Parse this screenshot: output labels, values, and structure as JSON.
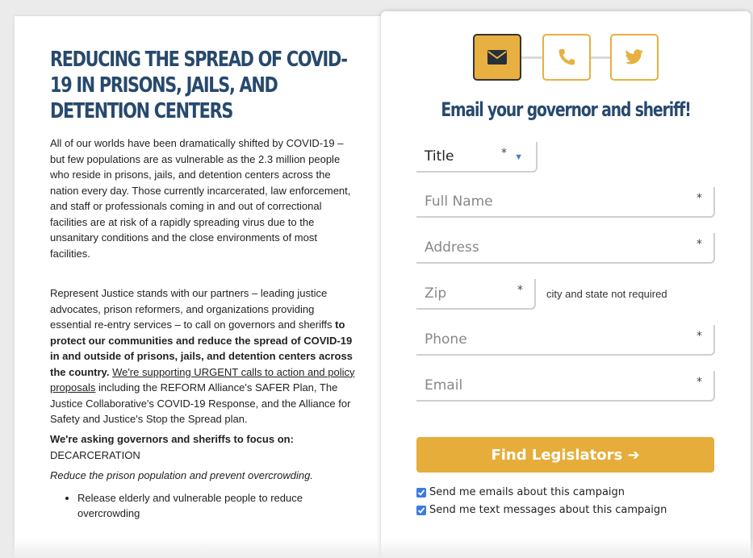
{
  "article": {
    "headline": "REDUCING THE SPREAD OF COVID-19 IN PRISONS, JAILS, AND DETENTION CENTERS",
    "para1": "All of our worlds have been dramatically shifted by COVID-19 – but few populations are as vulnerable as the 2.3 million people who reside in prisons, jails, and detention centers across the nation every day. Those currently incarcerated, law enforcement, and staff or professionals coming in and out of correctional facilities are at risk of a rapidly spreading virus due to the unsanitary conditions and the close environments of most facilities.",
    "para2_a": "Represent Justice stands with our partners – leading justice advocates, prison reformers, and organizations providing essential re-entry services –  to call on governors and sheriffs ",
    "para2_bold": "to protect our communities and reduce the spread of COVID-19 in and outside of prisons, jails, and detention centers across the country.",
    "para2_link": "We're supporting URGENT calls to action and policy proposals",
    "para2_b": " including the REFORM Alliance's SAFER Plan, The Justice Collaborative's COVID-19 Response, and the Alliance for Safety and Justice's Stop the Spread plan.",
    "asking_heading": "We're asking governors and sheriffs to focus on:",
    "section_title": "DECARCERATION",
    "section_subtitle": "Reduce the prison population and prevent overcrowding.",
    "bullets": [
      "Release elderly and vulnerable people to reduce overcrowding"
    ]
  },
  "form": {
    "steps": [
      {
        "icon": "envelope-icon",
        "active": true
      },
      {
        "icon": "phone-icon",
        "active": false
      },
      {
        "icon": "twitter-icon",
        "active": false
      }
    ],
    "title": "Email your governor and sheriff!",
    "title_select": {
      "value": "Title",
      "required_mark": "*"
    },
    "full_name": {
      "placeholder": "Full Name",
      "required_mark": "*"
    },
    "address": {
      "placeholder": "Address",
      "required_mark": "*"
    },
    "zip": {
      "placeholder": "Zip",
      "required_mark": "*"
    },
    "zip_note": "city and state not required",
    "phone": {
      "placeholder": "Phone",
      "required_mark": "*"
    },
    "email": {
      "placeholder": "Email",
      "required_mark": "*"
    },
    "submit_label": "Find Legislators ➔",
    "checkboxes": [
      {
        "label": "Send me emails about this campaign",
        "checked": true
      },
      {
        "label": "Send me text messages about this campaign",
        "checked": true
      }
    ]
  },
  "colors": {
    "heading": "#27496d",
    "accent": "#e6ad3a",
    "checkbox": "#3a7be0"
  }
}
